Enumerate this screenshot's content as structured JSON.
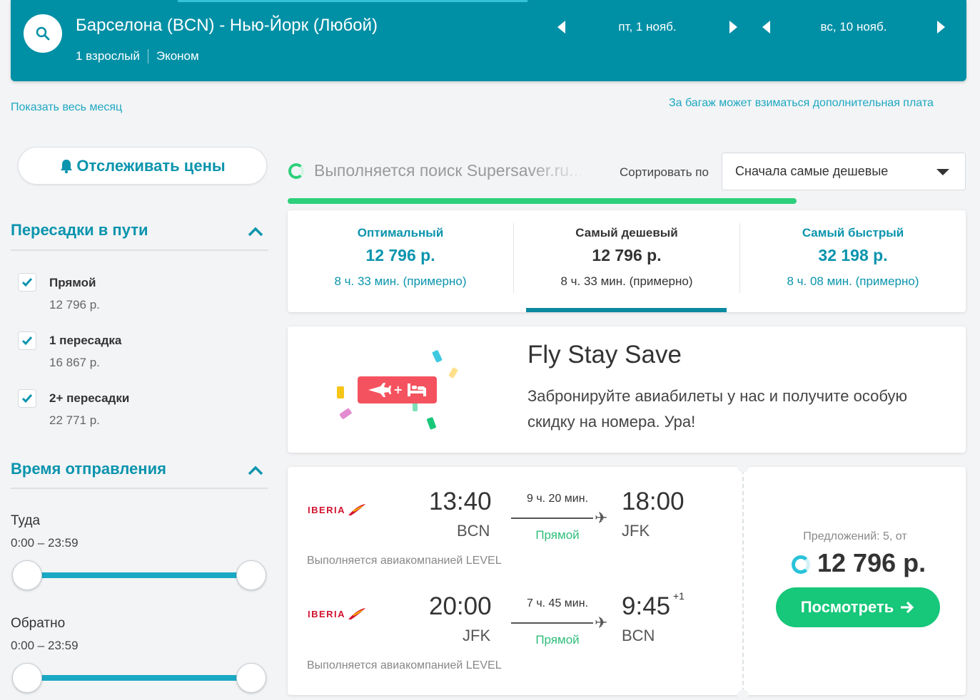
{
  "header": {
    "route": "Барселона (BCN) - Нью-Йорк (Любой)",
    "passengers": "1 взрослый",
    "cabin": "Эконом",
    "depart_date": "пт, 1 нояб.",
    "return_date": "вс, 10 нояб."
  },
  "links": {
    "show_month": "Показать весь месяц",
    "baggage_note": "За багаж может взиматься дополнительная плата"
  },
  "sidebar": {
    "track_prices": "Отслеживать цены",
    "stops": {
      "title": "Пересадки в пути",
      "options": [
        {
          "label": "Прямой",
          "price": "12 796 р.",
          "checked": true
        },
        {
          "label": "1 пересадка",
          "price": "16 867 р.",
          "checked": true
        },
        {
          "label": "2+ пересадки",
          "price": "22 771 р.",
          "checked": true
        }
      ]
    },
    "departure_time": {
      "title": "Время отправления",
      "outbound": {
        "label": "Туда",
        "range": "0:00 – 23:59"
      },
      "inbound": {
        "label": "Обратно",
        "range": "0:00 – 23:59"
      }
    }
  },
  "search": {
    "status": "Выполняется поиск Supersaver.ru...",
    "progress": 0.75,
    "sort_label": "Сортировать по",
    "sort_value": "Сначала самые дешевые"
  },
  "summary_tabs": [
    {
      "label": "Оптимальный",
      "price": "12 796 р.",
      "duration": "8 ч. 33 мин. (примерно)",
      "active": false
    },
    {
      "label": "Самый дешевый",
      "price": "12 796 р.",
      "duration": "8 ч. 33 мин. (примерно)",
      "active": true
    },
    {
      "label": "Самый быстрый",
      "price": "32 198 р.",
      "duration": "8 ч. 08 мин. (примерно)",
      "active": false
    }
  ],
  "promo": {
    "title": "Fly Stay Save",
    "text": "Забронируйте авиабилеты у нас и получите особую скидку на номера. Ура!"
  },
  "result": {
    "airline": "IBERIA",
    "legs": [
      {
        "dep_time": "13:40",
        "dep_code": "BCN",
        "duration": "9 ч. 20 мин.",
        "stops": "Прямой",
        "arr_time": "18:00",
        "arr_code": "JFK",
        "day_offset": "",
        "operated_by": "Выполняется авиакомпанией LEVEL"
      },
      {
        "dep_time": "20:00",
        "dep_code": "JFK",
        "duration": "7 ч. 45 мин.",
        "stops": "Прямой",
        "arr_time": "9:45",
        "arr_code": "BCN",
        "day_offset": "+1",
        "operated_by": "Выполняется авиакомпанией LEVEL"
      }
    ],
    "offers": "Предложений: 5, от",
    "price": "12 796 р.",
    "view_button": "Посмотреть"
  },
  "colors": {
    "header_bg": "#0090a6",
    "accent_blue": "#0b94ad",
    "accent_green": "#17c77a",
    "brand_red": "#d2122e"
  }
}
